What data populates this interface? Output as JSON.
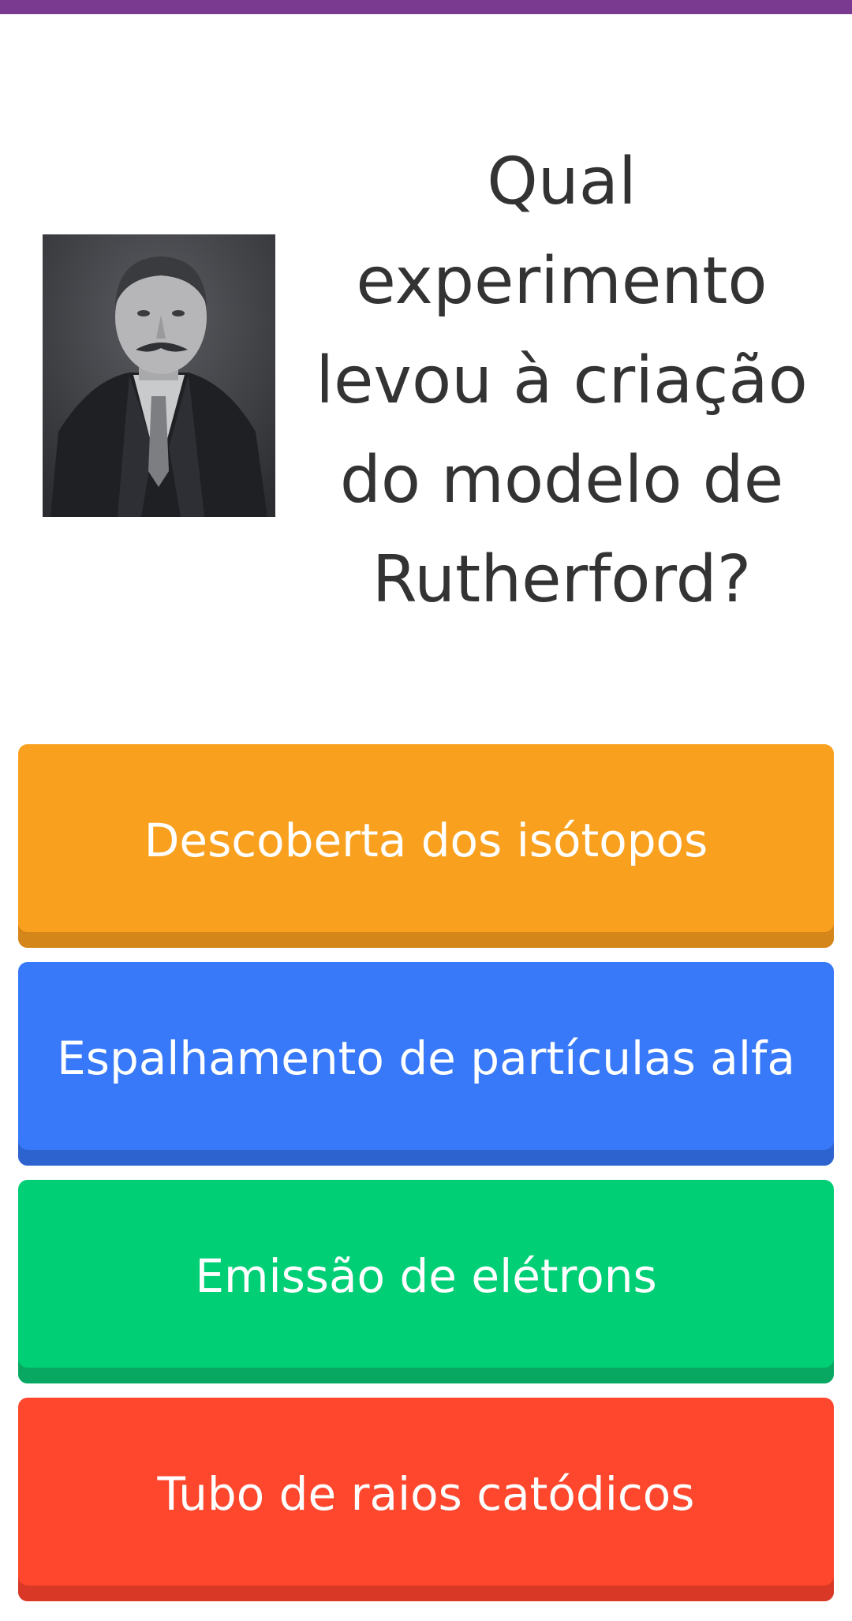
{
  "colors": {
    "top_bar": "#7a3a8f",
    "question_text": "#333333",
    "option_orange": "#f9a11f",
    "option_blue": "#3779f8",
    "option_green": "#00cf75",
    "option_red": "#fe472d"
  },
  "question": {
    "lines": [
      "Qual",
      "experimento",
      "levou à criação",
      "do modelo de",
      "Rutherford?"
    ],
    "image_icon": "portrait-photo"
  },
  "options": [
    {
      "label": "Descoberta dos isótopos",
      "color": "#f9a11f"
    },
    {
      "label": "Espalhamento de partículas alfa",
      "color": "#3779f8"
    },
    {
      "label": "Emissão de elétrons",
      "color": "#00cf75"
    },
    {
      "label": "Tubo de raios catódicos",
      "color": "#fe472d"
    }
  ]
}
